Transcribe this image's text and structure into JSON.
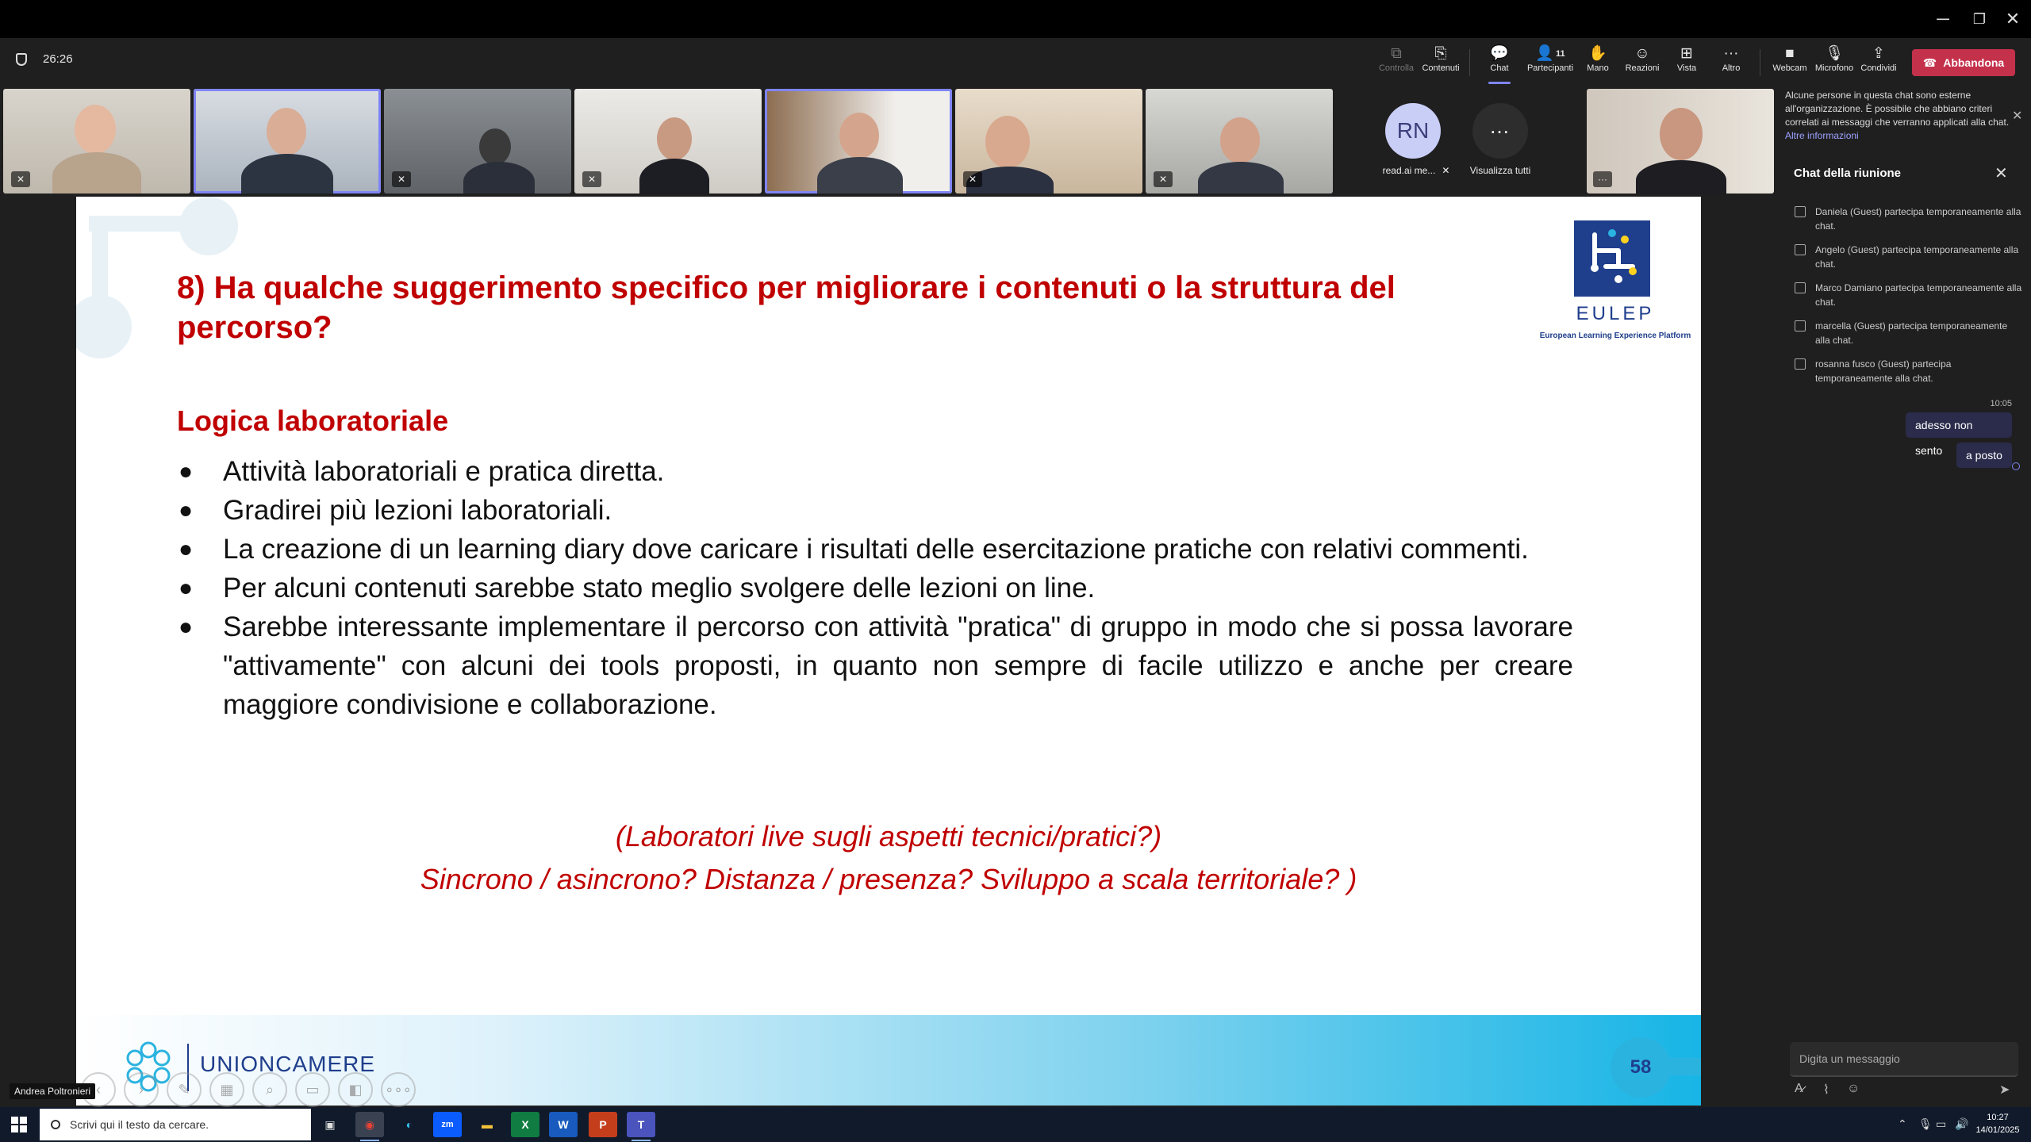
{
  "window": {
    "minimize": "─",
    "restore": "❐",
    "close": "✕"
  },
  "meeting": {
    "elapsed": "26:26",
    "toolbar": {
      "control": "Controlla",
      "content": "Contenuti",
      "chat": "Chat",
      "participants": "Partecipanti",
      "participants_count": "11",
      "hand": "Mano",
      "reactions": "Reazioni",
      "view": "Vista",
      "more": "Altro",
      "webcam": "Webcam",
      "mic": "Microfono",
      "share": "Condividi",
      "leave": "Abbandona"
    },
    "avatar": {
      "initials": "RN",
      "name": "read.ai me..."
    },
    "see_all": "Visualizza tutti"
  },
  "slide": {
    "title": "8) Ha qualche suggerimento specifico per migliorare i contenuti o la struttura del percorso?",
    "logo_text": "EULEP",
    "logo_sub": "European Learning Experience Platform",
    "section": "Logica laboratoriale",
    "bullets": [
      "Attività laboratoriali e pratica diretta.",
      "Gradirei più lezioni laboratoriali.",
      "La creazione di un learning diary dove caricare i risultati delle esercitazione pratiche con relativi commenti.",
      "Per alcuni contenuti sarebbe stato meglio svolgere delle lezioni on line.",
      "Sarebbe interessante implementare il percorso con attività \"pratica\" di gruppo in modo che si possa lavorare \"attivamente\" con alcuni dei tools proposti, in quanto non sempre di facile utilizzo e anche per creare maggiore condivisione e collaborazione."
    ],
    "question1": "(Laboratori live sugli aspetti tecnici/pratici?)",
    "question2": "Sincrono / asincrono? Distanza / presenza? Sviluppo a scala territoriale? )",
    "footer_brand": "UNIONCAMERE",
    "page_number": "58"
  },
  "presenter_name": "Andrea Poltronieri",
  "chat": {
    "banner": "Alcune persone in questa chat sono esterne all'organizzazione. È possibile che abbiano criteri correlati ai messaggi che verranno applicati alla chat.",
    "banner_link": "Altre informazioni",
    "title": "Chat della riunione",
    "system_messages": [
      "Daniela (Guest) partecipa temporaneamente alla chat.",
      "Angelo (Guest) partecipa temporaneamente alla chat.",
      "Marco Damiano partecipa temporaneamente alla chat.",
      "marcella (Guest) partecipa temporaneamente alla chat.",
      "rosanna fusco (Guest) partecipa temporaneamente alla chat."
    ],
    "message_time": "10:05",
    "messages": [
      "adesso non sento",
      "a posto"
    ],
    "compose_placeholder": "Digita un messaggio"
  },
  "taskbar": {
    "search_placeholder": "Scrivi qui il testo da cercare.",
    "time": "10:27",
    "date": "14/01/2025"
  },
  "colors": {
    "accent": "#7f85f5",
    "leave": "#c4314b",
    "slide_red": "#c00000",
    "brand_blue": "#1f3e8c"
  }
}
